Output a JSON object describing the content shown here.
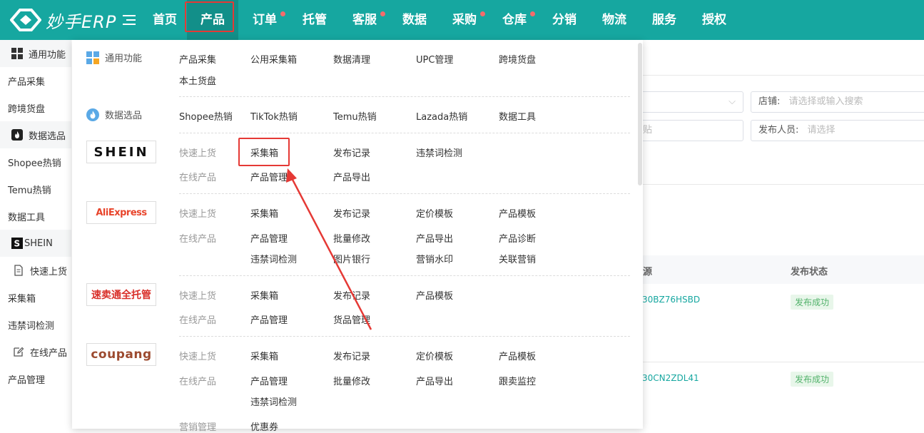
{
  "app": {
    "logo_text": "妙手ERP"
  },
  "nav": [
    "首页",
    "产品",
    "订单",
    "托管",
    "客服",
    "数据",
    "采购",
    "仓库",
    "分销",
    "物流",
    "服务",
    "授权"
  ],
  "sidebar": [
    {
      "label": "通用功能",
      "icon": "grid-icon"
    },
    {
      "label": "产品采集"
    },
    {
      "label": "跨境货盘"
    },
    {
      "label": "数据选品",
      "icon": "flame-icon"
    },
    {
      "label": "Shopee热销"
    },
    {
      "label": "Temu热销"
    },
    {
      "label": "数据工具"
    },
    {
      "label": "SHEIN",
      "icon": "shein-icon"
    },
    {
      "label": "快速上货",
      "icon": "document-icon"
    },
    {
      "label": "采集箱"
    },
    {
      "label": "违禁词检测"
    },
    {
      "label": "在线产品",
      "icon": "edit-icon"
    },
    {
      "label": "产品管理"
    }
  ],
  "background": {
    "store_label": "店铺:",
    "store_placeholder": "请选择或输入搜索",
    "publisher_label": "发布人员:",
    "publisher_placeholder": "请选择",
    "partial_text": "贴",
    "col_source": "源",
    "col_status": "发布状态",
    "rows": [
      {
        "id": "30BZ76HSBD",
        "status": "发布成功"
      },
      {
        "id": "30CN2ZDL41",
        "status": "发布成功"
      }
    ]
  },
  "dropdown": {
    "general": {
      "title": "通用功能",
      "links": [
        "产品采集",
        "公用采集箱",
        "数据清理",
        "UPC管理",
        "跨境货盘",
        "本土货盘"
      ]
    },
    "data": {
      "title": "数据选品",
      "links": [
        "Shopee热销",
        "TikTok热销",
        "Temu热销",
        "Lazada热销",
        "数据工具"
      ]
    },
    "shein": {
      "brand": "SHEIN",
      "quick_label": "快速上货",
      "quick_links": [
        "采集箱",
        "发布记录",
        "违禁词检测"
      ],
      "online_label": "在线产品",
      "online_links": [
        "产品管理",
        "产品导出"
      ]
    },
    "aliexpress": {
      "brand": "AliExpress",
      "quick_label": "快速上货",
      "quick_links": [
        "采集箱",
        "发布记录",
        "定价模板",
        "产品模板"
      ],
      "online_label": "在线产品",
      "online_links": [
        "产品管理",
        "批量修改",
        "产品导出",
        "产品诊断",
        "违禁词检测",
        "图片银行",
        "营销水印",
        "关联营销"
      ]
    },
    "smt": {
      "brand": "速卖通全托管",
      "quick_label": "快速上货",
      "quick_links": [
        "采集箱",
        "发布记录",
        "产品模板"
      ],
      "online_label": "在线产品",
      "online_links": [
        "产品管理",
        "货品管理"
      ]
    },
    "coupang": {
      "brand": "coupang",
      "quick_label": "快速上货",
      "quick_links": [
        "采集箱",
        "发布记录",
        "定价模板",
        "产品模板"
      ],
      "online_label": "在线产品",
      "online_links": [
        "产品管理",
        "批量修改",
        "产品导出",
        "跟卖监控",
        "违禁词检测"
      ],
      "marketing_label": "营销管理",
      "marketing_links": [
        "优惠券"
      ]
    }
  },
  "colors": {
    "brand": "#16a7a0",
    "highlight": "#e53935"
  }
}
